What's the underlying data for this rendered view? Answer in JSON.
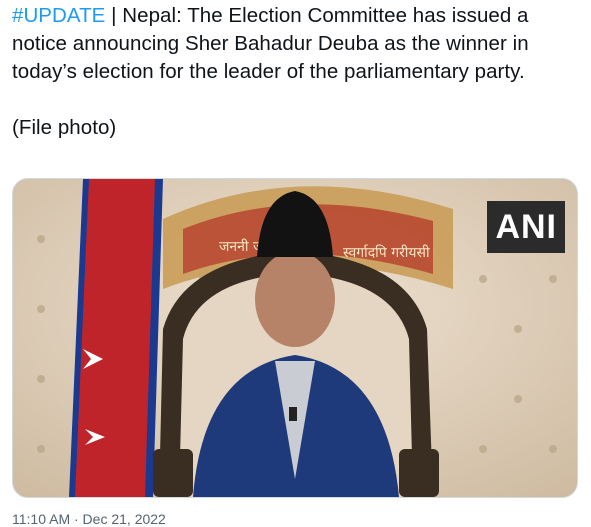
{
  "tweet": {
    "hashtag": "#UPDATE",
    "separator": " | ",
    "body": "Nepal: The Election Committee has issued a notice announcing Sher Bahadur Deuba as the winner in today’s election for the leader of the parliamentary party.",
    "note": "(File photo)"
  },
  "media": {
    "watermark": "ANI",
    "emblem_lettering_left": "जननी ज",
    "emblem_lettering_right": "स्वर्गादपि गरीयसी"
  },
  "meta": {
    "timestamp": "11:10 AM · Dec 21, 2022"
  },
  "colors": {
    "hashtag": "#1d9bf0",
    "text": "#0f1419",
    "muted": "#536471",
    "border": "#cfd9de"
  }
}
